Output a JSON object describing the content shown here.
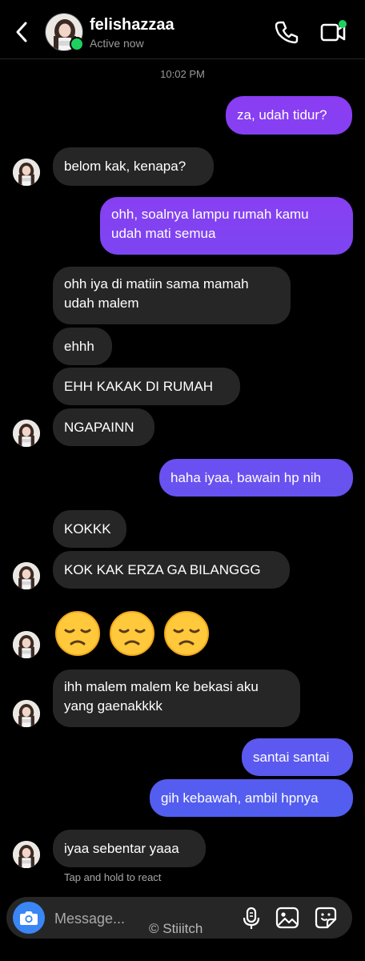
{
  "header": {
    "username": "felishazzaa",
    "status": "Active now"
  },
  "thread": {
    "timestamp": "10:02 PM",
    "messages": [
      {
        "from": "me",
        "text": "za, udah tidur?"
      },
      {
        "from": "them",
        "text": "belom kak, kenapa?"
      },
      {
        "from": "me",
        "text": "ohh, soalnya lampu rumah kamu udah mati semua"
      },
      {
        "from": "them",
        "text": "ohh iya di matiin sama mamah udah malem"
      },
      {
        "from": "them",
        "text": "ehhh"
      },
      {
        "from": "them",
        "text": "EHH KAKAK DI RUMAH"
      },
      {
        "from": "them",
        "text": "NGAPAINN"
      },
      {
        "from": "me",
        "text": "haha iyaa, bawain hp nih"
      },
      {
        "from": "them",
        "text": "KOKKK"
      },
      {
        "from": "them",
        "text": "KOK KAK ERZA GA BILANGGG"
      },
      {
        "from": "them",
        "text": "😞😞😞",
        "emoji": "disappointed-face"
      },
      {
        "from": "them",
        "text": "ihh malem malem ke bekasi aku yang gaenakkkk"
      },
      {
        "from": "me",
        "text": "santai santai"
      },
      {
        "from": "me",
        "text": "gih kebawah, ambil hpnya"
      },
      {
        "from": "them",
        "text": "iyaa sebentar yaaa"
      }
    ],
    "react_hint": "Tap and hold to react"
  },
  "composer": {
    "placeholder": "Message...",
    "icons": [
      "camera-icon",
      "microphone-icon",
      "gallery-icon",
      "sticker-icon"
    ]
  },
  "watermark": "© Stiiitch",
  "colors": {
    "background": "#000000",
    "incoming_bubble": "#262626",
    "outgoing_gradient_top": "#8a3ef2",
    "outgoing_gradient_bottom": "#4f5ff0",
    "online": "#1ed05f",
    "camera_button": "#3a86f5"
  }
}
